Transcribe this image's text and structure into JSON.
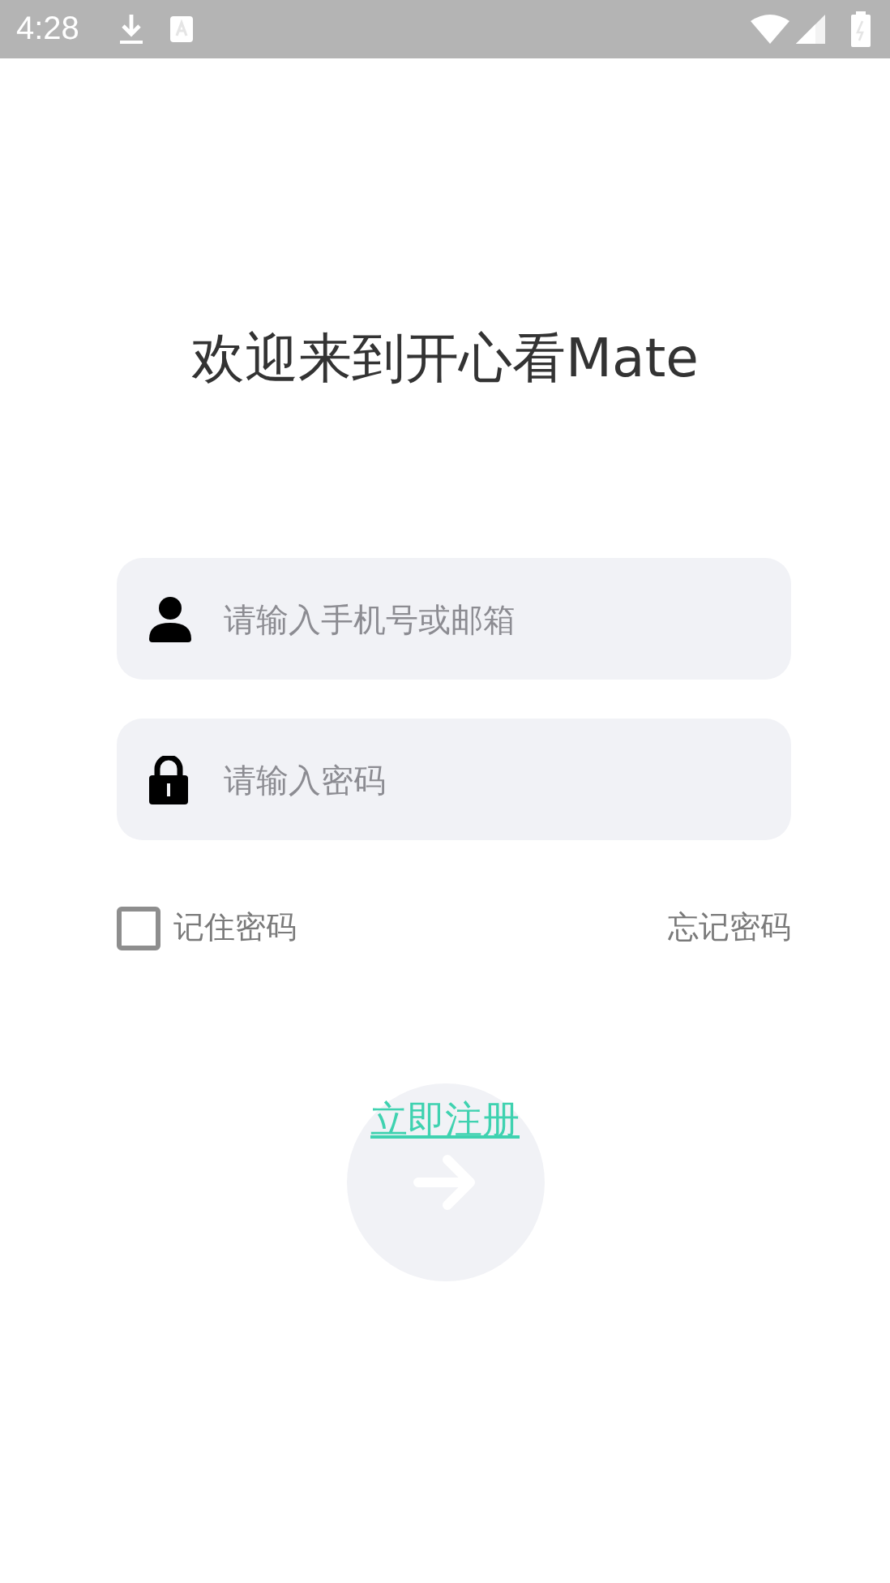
{
  "status_bar": {
    "time": "4:28"
  },
  "title": "欢迎来到开心看Mate",
  "fields": [
    {
      "kind": "user",
      "placeholder": "请输入手机号或邮箱"
    },
    {
      "kind": "password",
      "placeholder": "请输入密码"
    }
  ],
  "remember": {
    "label": "记住密码",
    "checked": false
  },
  "forgot": "忘记密码",
  "register": "立即注册"
}
